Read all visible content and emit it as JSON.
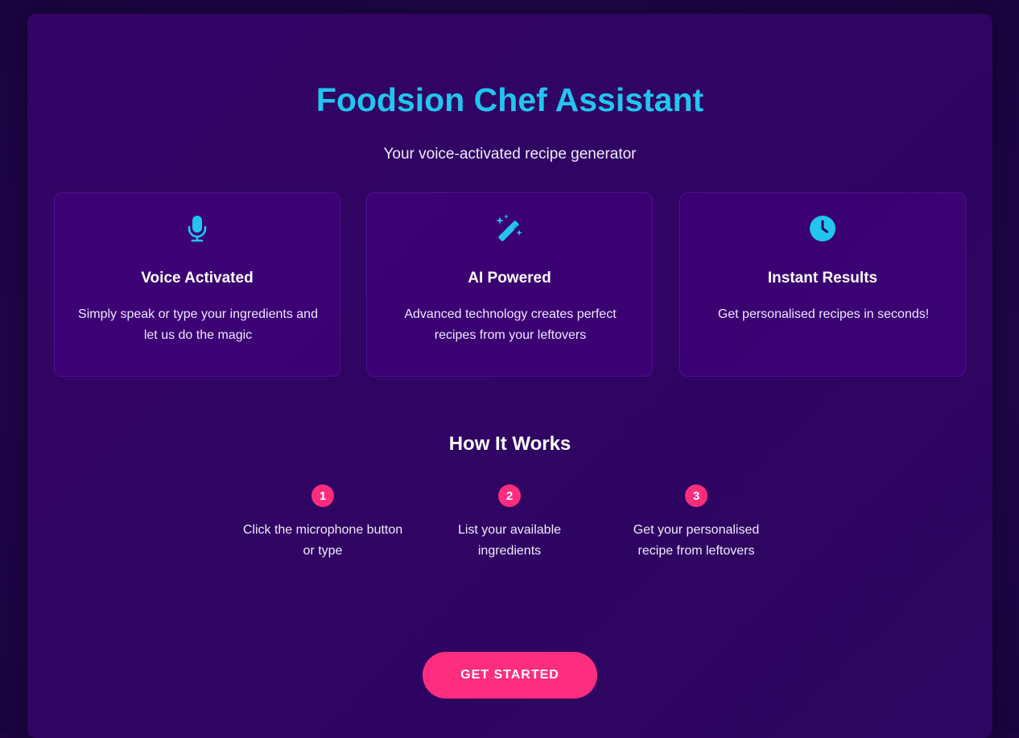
{
  "header": {
    "title": "Foodsion Chef Assistant",
    "subtitle": "Your voice-activated recipe generator"
  },
  "features": [
    {
      "icon": "microphone-icon",
      "title": "Voice Activated",
      "description": "Simply speak or type your ingredients and let us do the magic"
    },
    {
      "icon": "magic-wand-icon",
      "title": "AI Powered",
      "description": "Advanced technology creates perfect recipes from your leftovers"
    },
    {
      "icon": "clock-icon",
      "title": "Instant Results",
      "description": "Get personalised recipes in seconds!"
    }
  ],
  "how_it_works": {
    "title": "How It Works",
    "steps": [
      {
        "number": "1",
        "text": "Click the microphone button or type"
      },
      {
        "number": "2",
        "text": "List your available ingredients"
      },
      {
        "number": "3",
        "text": "Get your personalised recipe from leftovers"
      }
    ]
  },
  "cta": {
    "label": "GET STARTED"
  },
  "colors": {
    "accent": "#22c5ee",
    "cta": "#ff2d7e",
    "background": "#2f0462"
  }
}
